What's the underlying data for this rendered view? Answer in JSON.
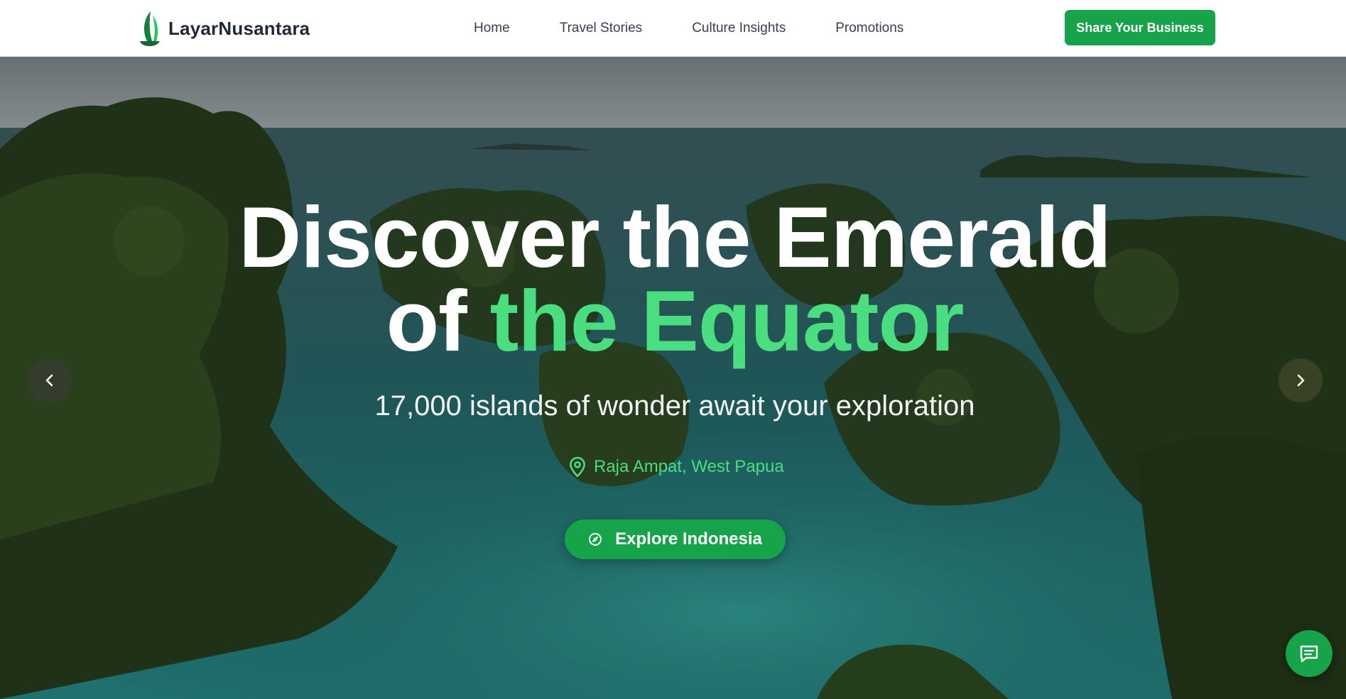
{
  "brand": {
    "name": "LayarNusantara",
    "logo_icon": "sailboat-icon"
  },
  "nav": {
    "links": [
      {
        "label": "Home"
      },
      {
        "label": "Travel Stories"
      },
      {
        "label": "Culture Insights"
      },
      {
        "label": "Promotions"
      }
    ],
    "cta_label": "Share Your Business"
  },
  "hero": {
    "headline_part1": "Discover the Emerald",
    "headline_part2": "of ",
    "headline_accent": "the Equator",
    "subtitle": "17,000 islands of wonder await your exploration",
    "location": "Raja Ampat, West Papua",
    "location_icon": "map-pin-icon",
    "cta_label": "Explore Indonesia",
    "cta_icon": "compass-icon",
    "prev_icon": "chevron-left-icon",
    "next_icon": "chevron-right-icon"
  },
  "chat": {
    "icon": "chat-icon"
  },
  "colors": {
    "accent": "#16a34a",
    "accent_light": "#4ade80",
    "nav_text": "#374151",
    "brand_text": "#1f2937"
  }
}
